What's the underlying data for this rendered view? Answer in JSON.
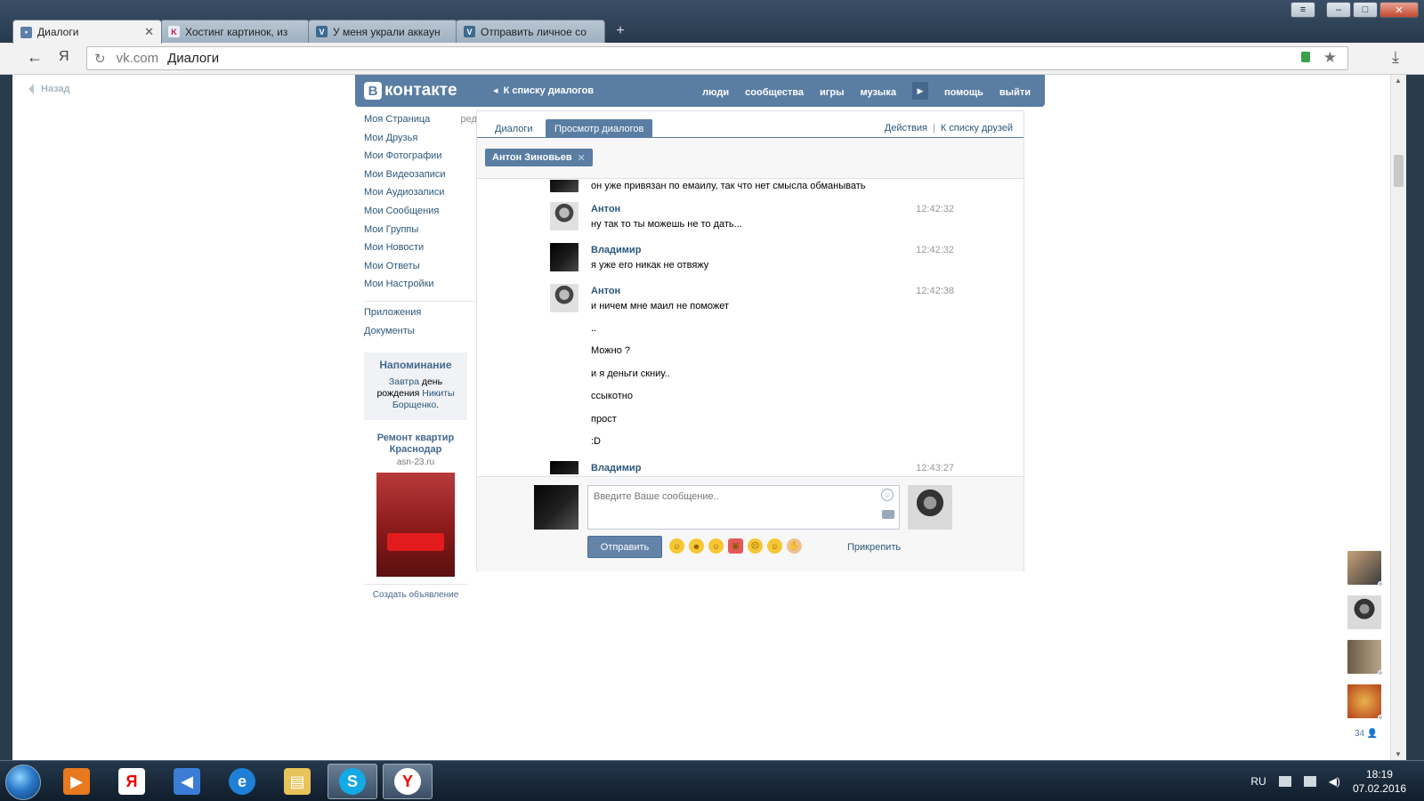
{
  "browser": {
    "tabs": [
      {
        "title": "Диалоги",
        "active": true
      },
      {
        "title": "Хостинг картинок, из",
        "active": false
      },
      {
        "title": "У меня украли аккаун",
        "active": false
      },
      {
        "title": "Отправить личное со",
        "active": false
      }
    ],
    "nav_ya": "Я",
    "domain": "vk.com",
    "page_title": "Диалоги"
  },
  "page": {
    "back_label": "Назад"
  },
  "vk_header": {
    "logo_letter": "В",
    "logo_text": "контакте",
    "back_to_list": "К списку диалогов",
    "nav": [
      "люди",
      "сообщества",
      "игры",
      "музыка",
      "помощь",
      "выйти"
    ]
  },
  "left_menu": {
    "items": [
      {
        "label": "Моя Страница",
        "extra": "ред."
      },
      {
        "label": "Мои Друзья"
      },
      {
        "label": "Мои Фотографии"
      },
      {
        "label": "Мои Видеозаписи"
      },
      {
        "label": "Мои Аудиозаписи"
      },
      {
        "label": "Мои Сообщения"
      },
      {
        "label": "Мои Группы"
      },
      {
        "label": "Мои Новости"
      },
      {
        "label": "Мои Ответы"
      },
      {
        "label": "Мои Настройки"
      }
    ],
    "extra_items": [
      {
        "label": "Приложения"
      },
      {
        "label": "Документы"
      }
    ],
    "reminder": {
      "title": "Напоминание",
      "w1": "Завтра",
      "w2": "день",
      "w3": "рождения",
      "w4": "Никиты",
      "w5": "Борщенко",
      "w6": "."
    },
    "ad": {
      "title": "Ремонт квартир Краснодар",
      "source": "asn-23.ru",
      "create": "Создать объявление"
    }
  },
  "dialog": {
    "tabs": [
      "Диалоги",
      "Просмотр диалогов"
    ],
    "actions": "Действия",
    "separator": "|",
    "friends_link": "К списку друзей",
    "peer": "Антон Зиновьев",
    "messages": [
      {
        "name": "",
        "time": "",
        "text": "он уже привязан по емаилу, так что нет смысла обманывать",
        "avatar": "vlad"
      },
      {
        "name": "Антон",
        "time": "12:42:32",
        "text": "ну так то ты можешь не то дать...",
        "avatar": "anton"
      },
      {
        "name": "Владимир",
        "time": "12:42:32",
        "text": "я уже его никак не отвяжу",
        "avatar": "vlad"
      },
      {
        "name": "Антон",
        "time": "12:42:38",
        "text": "и ничем мне маил не поможет",
        "avatar": "anton"
      },
      {
        "name": "Владимир",
        "time": "12:43:27",
        "text": "",
        "avatar": "vlad"
      }
    ],
    "continuation": [
      "..",
      "Можно ?",
      "и я деньги скниу..",
      "ссыкотно",
      "прост",
      ":D"
    ],
    "composer": {
      "placeholder": "Введите Ваше сообщение..",
      "send": "Отправить",
      "attach": "Прикрепить"
    }
  },
  "friends_rail": {
    "count": "34"
  },
  "taskbar": {
    "lang": "RU",
    "time": "18:19",
    "date": "07.02.2016"
  },
  "colors": {
    "vk_blue": "#597da3",
    "link": "#2b587a"
  }
}
